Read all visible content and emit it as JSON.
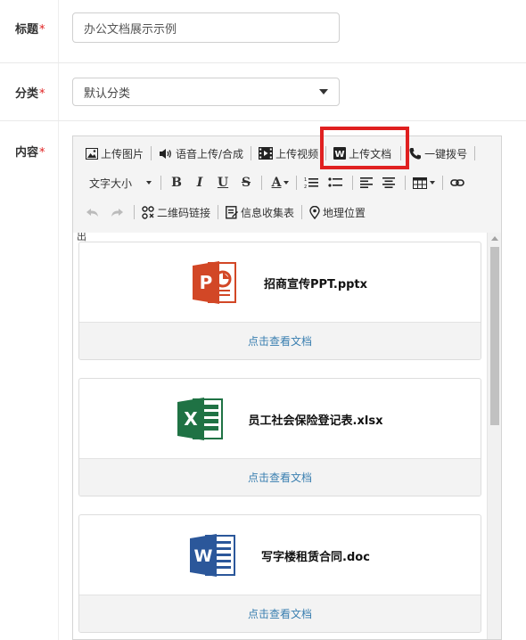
{
  "form": {
    "title_label": "标题",
    "title_value": "办公文档展示示例",
    "category_label": "分类",
    "category_value": "默认分类",
    "content_label": "内容",
    "required_mark": "*"
  },
  "toolbar": {
    "upload_image": "上传图片",
    "voice_upload": "语音上传/合成",
    "upload_video": "上传视频",
    "upload_document": "上传文档",
    "one_click_dial": "一键拨号",
    "font_size": "文字大小",
    "qr_link": "二维码链接",
    "info_form": "信息收集表",
    "location": "地理位置",
    "bold": "B",
    "italic": "I",
    "underline": "U",
    "strike": "S",
    "font_color": "A"
  },
  "content": {
    "cut_text": "出",
    "documents": [
      {
        "name": "招商宣传PPT.pptx",
        "type": "ppt",
        "action": "点击查看文档"
      },
      {
        "name": "员工社会保险登记表.xlsx",
        "type": "excel",
        "action": "点击查看文档"
      },
      {
        "name": "写字楼租赁合同.doc",
        "type": "word",
        "action": "点击查看文档"
      }
    ]
  },
  "colors": {
    "highlight": "#e02020",
    "link": "#3a7fb0",
    "ppt": "#d24726",
    "excel": "#1f7244",
    "word": "#2b579a"
  }
}
